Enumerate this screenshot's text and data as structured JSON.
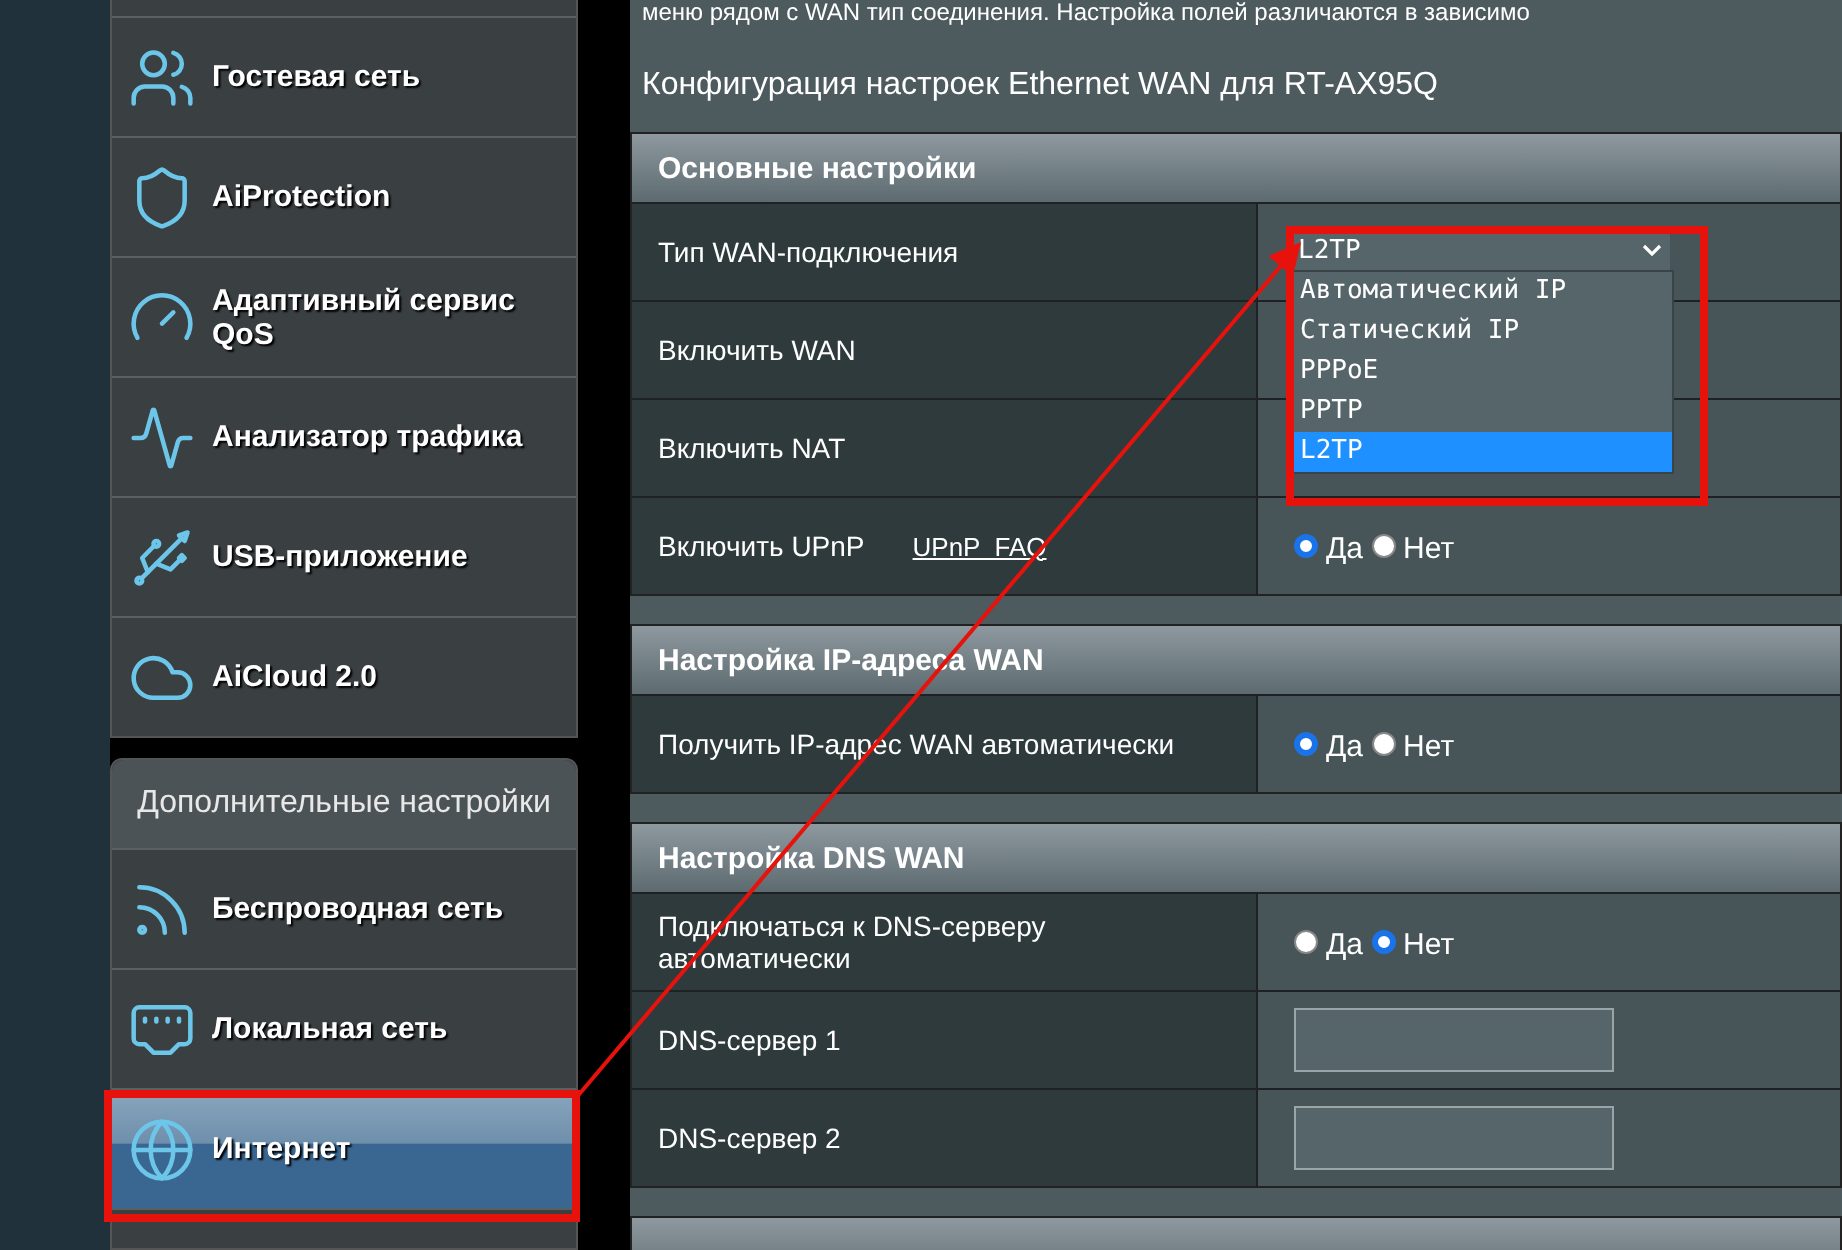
{
  "sidebar": {
    "top_items": [
      {
        "label": "Гостевая сеть",
        "selected": false
      },
      {
        "label": "AiProtection",
        "selected": false
      },
      {
        "label": "Адаптивный сервис QoS",
        "selected": false
      },
      {
        "label": "Анализатор трафика",
        "selected": false
      },
      {
        "label": "USB-приложение",
        "selected": false
      },
      {
        "label": "AiCloud 2.0",
        "selected": false
      }
    ],
    "advanced_title": "Дополнительные настройки",
    "advanced_items": [
      {
        "label": "Беспроводная сеть",
        "selected": false
      },
      {
        "label": "Локальная сеть",
        "selected": false
      },
      {
        "label": "Интернет",
        "selected": true
      }
    ]
  },
  "intro": "меню рядом с WAN тип соединения. Настройка полей различаются в зависимо",
  "config_title": "Конфигурация настроек Ethernet WAN для RT-AX95Q",
  "sections": [
    {
      "title": "Основные настройки",
      "rows": [
        {
          "kind": "select",
          "label": "Тип WAN-подключения",
          "value": "L2TP",
          "expanded": true,
          "options": [
            {
              "label": "Автоматический IP",
              "selected": false
            },
            {
              "label": "Статический IP",
              "selected": false
            },
            {
              "label": "PPPoE",
              "selected": false
            },
            {
              "label": "PPTP",
              "selected": false
            },
            {
              "label": "L2TP",
              "selected": true
            }
          ]
        },
        {
          "kind": "blank",
          "label": "Включить WAN"
        },
        {
          "kind": "blank",
          "label": "Включить NAT"
        },
        {
          "kind": "radio",
          "label": "Включить UPnP",
          "link": "UPnP  FAQ",
          "options": [
            {
              "label": "Да",
              "selected": true
            },
            {
              "label": "Нет",
              "selected": false
            }
          ]
        }
      ]
    },
    {
      "title": "Настройка IP-адреса WAN",
      "rows": [
        {
          "kind": "radio",
          "label": "Получить IP-адрес WAN автоматически",
          "options": [
            {
              "label": "Да",
              "selected": true
            },
            {
              "label": "Нет",
              "selected": false
            }
          ]
        }
      ]
    },
    {
      "title": "Настройка DNS WAN",
      "rows": [
        {
          "kind": "radio",
          "label": "Подключаться к DNS-серверу автоматически",
          "options": [
            {
              "label": "Да",
              "selected": false
            },
            {
              "label": "Нет",
              "selected": true
            }
          ]
        },
        {
          "kind": "input",
          "label": "DNS-сервер 1"
        },
        {
          "kind": "input",
          "label": "DNS-сервер 2"
        }
      ]
    }
  ]
}
